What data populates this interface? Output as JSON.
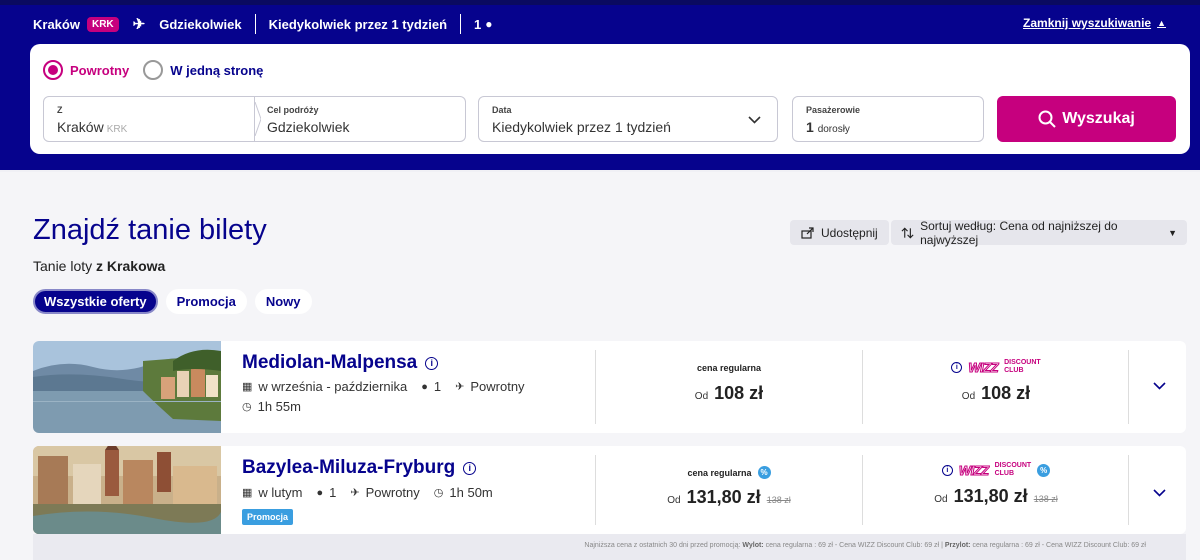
{
  "summary": {
    "origin": "Kraków",
    "origin_code": "KRK",
    "destination": "Gdziekolwiek",
    "dates": "Kiedykolwiek przez 1 tydzień",
    "passengers": "1",
    "close_search": "Zamknij wyszukiwanie"
  },
  "search": {
    "trip_types": [
      "Powrotny",
      "W jedną stronę"
    ],
    "selected_trip_type": "Powrotny",
    "from_label": "Z",
    "from_value": "Kraków",
    "from_code": "KRK",
    "to_label": "Cel podróży",
    "to_value": "Gdziekolwiek",
    "date_label": "Data",
    "date_value": "Kiedykolwiek przez 1 tydzień",
    "pax_label": "Pasażerowie",
    "pax_count": "1",
    "pax_type": "dorosły",
    "search_button": "Wyszukaj"
  },
  "main": {
    "title": "Znajdź tanie bilety",
    "subtitle_prefix": "Tanie loty",
    "subtitle_bold": "z Krakowa",
    "share_label": "Udostępnij",
    "sort_label": "Sortuj według: Cena od najniższej do najwyższej",
    "filters": [
      "Wszystkie oferty",
      "Promocja",
      "Nowy"
    ],
    "active_filter": "Wszystkie oferty"
  },
  "offers": [
    {
      "destination": "Mediolan-Malpensa",
      "dates": "w września - października",
      "passengers": "1",
      "trip": "Powrotny",
      "duration": "1h 55m",
      "regular_label": "cena regularna",
      "regular_prefix": "Od",
      "regular_price": "108 zł",
      "club_prefix": "Od",
      "club_price": "108 zł"
    },
    {
      "destination": "Bazylea-Miluza-Fryburg",
      "dates": "w lutym",
      "passengers": "1",
      "trip": "Powrotny",
      "duration": "1h 50m",
      "badge": "Promocja",
      "regular_label": "cena regularna",
      "regular_prefix": "Od",
      "regular_price": "131,80 zł",
      "regular_old": "138 zł",
      "club_prefix": "Od",
      "club_price": "131,80 zł",
      "club_old": "138 zł"
    }
  ],
  "club": {
    "brand": "WIZZ",
    "line1": "DISCOUNT",
    "line2": "CLUB",
    "percent": "%"
  },
  "footnote": {
    "text1": "Najniższa cena z ostatnich 30 dni przed promocją:",
    "out_label": "Wylot:",
    "out_text": "cena regularna : 69 zł - Cena WIZZ Discount Club: 69 zł",
    "in_label": "Przylot:",
    "in_text": "cena regularna : 69 zł - Cena WIZZ Discount Club: 69 zł"
  },
  "colors": {
    "brand_navy": "#06038d",
    "brand_magenta": "#c6007e",
    "promo_blue": "#3a9ee0"
  }
}
